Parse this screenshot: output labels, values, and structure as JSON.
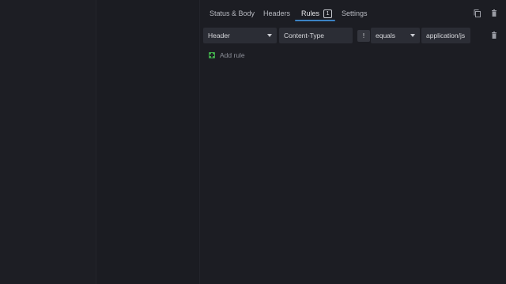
{
  "tabs": [
    {
      "label": "Status & Body"
    },
    {
      "label": "Headers"
    },
    {
      "label": "Rules",
      "badge": "1"
    },
    {
      "label": "Settings"
    }
  ],
  "toolbar": {
    "copy_icon": "copy-icon",
    "delete_icon": "trash-icon"
  },
  "rule": {
    "source": "Header",
    "name": "Content-Type",
    "negate": "!",
    "operator": "equals",
    "value": "application/js",
    "delete_icon": "trash-icon"
  },
  "add_rule": {
    "label": "Add rule",
    "icon": "plus-square-icon"
  },
  "colors": {
    "accent": "#3b82c4",
    "add_icon": "#3fa649",
    "background": "#1c1d23",
    "field_bg": "#2b2d35"
  }
}
